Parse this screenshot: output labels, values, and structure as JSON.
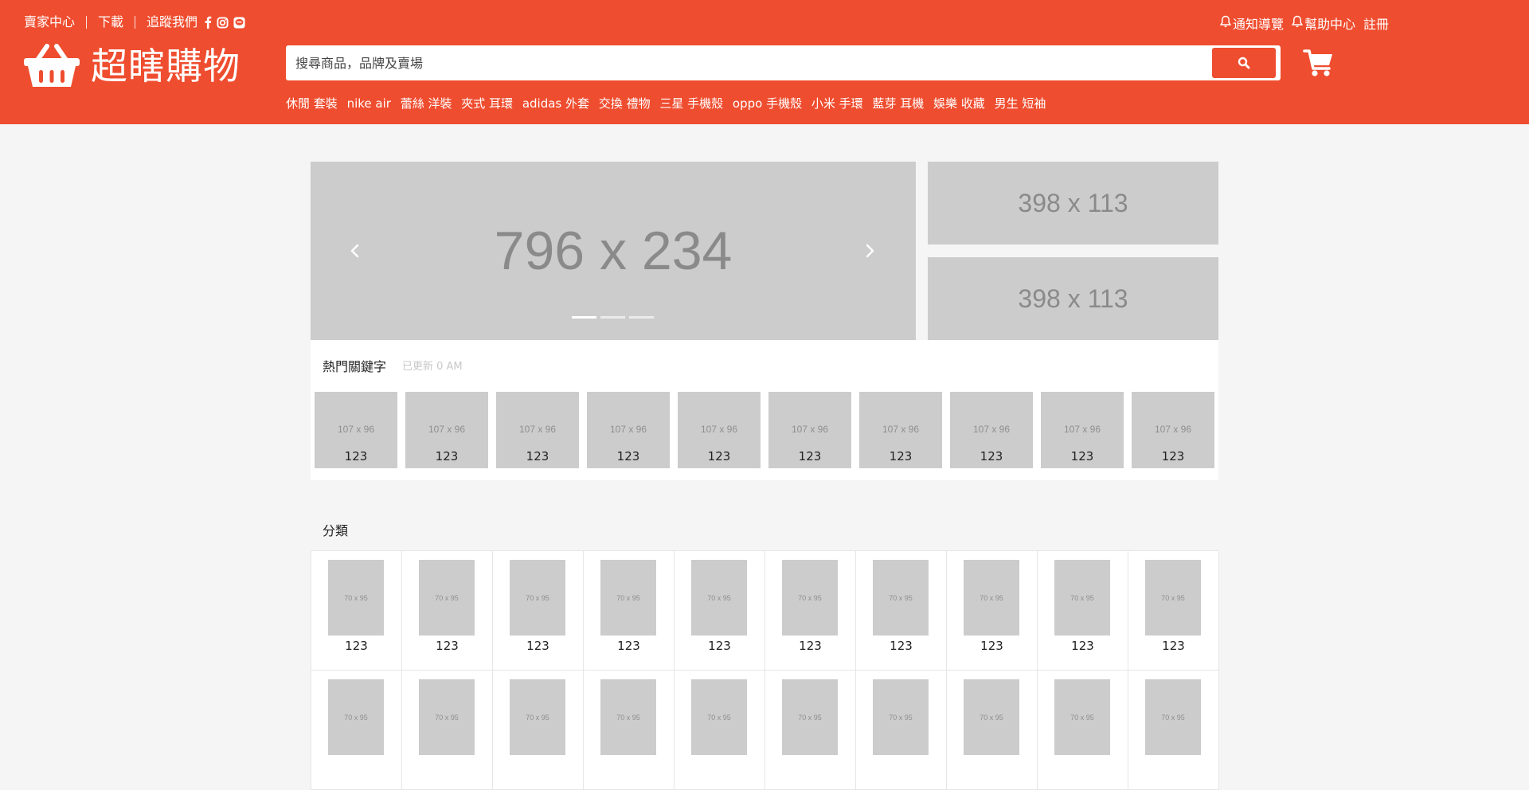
{
  "topbar": {
    "seller_center": "賣家中心",
    "download": "下載",
    "follow_us": "追蹤我們",
    "notifications": "通知導覽",
    "help_center": "幫助中心",
    "register": "註冊"
  },
  "brand": {
    "name": "超瞎購物"
  },
  "search": {
    "placeholder": "搜尋商品，品牌及賣場"
  },
  "keywords": [
    "休閒 套裝",
    "nike air",
    "蕾絲 洋裝",
    "夾式 耳環",
    "adidas 外套",
    "交換 禮物",
    "三星 手機殼",
    "oppo 手機殼",
    "小米 手環",
    "藍芽 耳機",
    "娛樂 收藏",
    "男生 短袖"
  ],
  "banner": {
    "main_label": "796 x 234",
    "side_top_label": "398 x 113",
    "side_bottom_label": "398 x 113",
    "slide_count": 3,
    "active_slide": 1
  },
  "hot_keywords": {
    "title": "熱門關鍵字",
    "updated": "已更新 0 AM",
    "tiles": [
      {
        "placeholder": "107 x 96",
        "label": "123"
      },
      {
        "placeholder": "107 x 96",
        "label": "123"
      },
      {
        "placeholder": "107 x 96",
        "label": "123"
      },
      {
        "placeholder": "107 x 96",
        "label": "123"
      },
      {
        "placeholder": "107 x 96",
        "label": "123"
      },
      {
        "placeholder": "107 x 96",
        "label": "123"
      },
      {
        "placeholder": "107 x 96",
        "label": "123"
      },
      {
        "placeholder": "107 x 96",
        "label": "123"
      },
      {
        "placeholder": "107 x 96",
        "label": "123"
      },
      {
        "placeholder": "107 x 96",
        "label": "123"
      }
    ]
  },
  "categories": {
    "title": "分類",
    "items": [
      {
        "placeholder": "70 x 95",
        "label": "123"
      },
      {
        "placeholder": "70 x 95",
        "label": "123"
      },
      {
        "placeholder": "70 x 95",
        "label": "123"
      },
      {
        "placeholder": "70 x 95",
        "label": "123"
      },
      {
        "placeholder": "70 x 95",
        "label": "123"
      },
      {
        "placeholder": "70 x 95",
        "label": "123"
      },
      {
        "placeholder": "70 x 95",
        "label": "123"
      },
      {
        "placeholder": "70 x 95",
        "label": "123"
      },
      {
        "placeholder": "70 x 95",
        "label": "123"
      },
      {
        "placeholder": "70 x 95",
        "label": "123"
      },
      {
        "placeholder": "70 x 95",
        "label": ""
      },
      {
        "placeholder": "70 x 95",
        "label": ""
      },
      {
        "placeholder": "70 x 95",
        "label": ""
      },
      {
        "placeholder": "70 x 95",
        "label": ""
      },
      {
        "placeholder": "70 x 95",
        "label": ""
      },
      {
        "placeholder": "70 x 95",
        "label": ""
      },
      {
        "placeholder": "70 x 95",
        "label": ""
      },
      {
        "placeholder": "70 x 95",
        "label": ""
      },
      {
        "placeholder": "70 x 95",
        "label": ""
      },
      {
        "placeholder": "70 x 95",
        "label": ""
      }
    ]
  },
  "icons": {
    "facebook": "facebook-icon",
    "instagram": "instagram-icon",
    "line": "line-icon",
    "bell": "bell-icon",
    "search": "search-icon",
    "cart": "cart-icon",
    "logo": "basket-logo-icon",
    "prev": "chevron-left-icon",
    "next": "chevron-right-icon"
  },
  "colors": {
    "brand": "#ef4d2f",
    "page_bg": "#f5f5f5",
    "placeholder": "#cccccc"
  }
}
